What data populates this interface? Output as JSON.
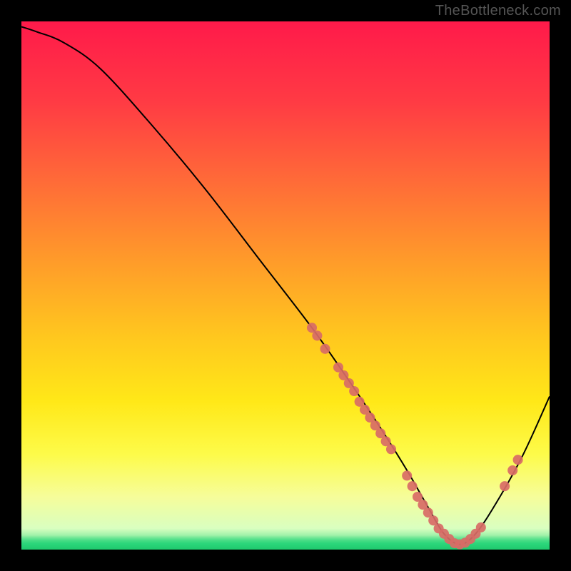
{
  "watermark": "TheBottleneck.com",
  "chart_data": {
    "type": "line",
    "title": "",
    "xlabel": "",
    "ylabel": "",
    "xlim": [
      0,
      100
    ],
    "ylim": [
      0,
      100
    ],
    "series": [
      {
        "name": "bottleneck-curve",
        "x": [
          0,
          3,
          8,
          15,
          25,
          35,
          45,
          55,
          62,
          68,
          73,
          77,
          80,
          83,
          86,
          90,
          95,
          100
        ],
        "y": [
          99,
          98,
          96,
          91,
          80,
          68,
          55,
          42,
          32,
          23,
          15,
          8,
          3,
          1,
          3,
          9,
          18,
          29
        ]
      }
    ],
    "scatter_clusters": [
      {
        "name": "dots-on-curve",
        "color": "#d86b66",
        "points": [
          {
            "x": 55,
            "y": 42
          },
          {
            "x": 56,
            "y": 40.5
          },
          {
            "x": 57.5,
            "y": 38
          },
          {
            "x": 60,
            "y": 34.5
          },
          {
            "x": 61,
            "y": 33
          },
          {
            "x": 62,
            "y": 31.5
          },
          {
            "x": 63,
            "y": 30
          },
          {
            "x": 64,
            "y": 28
          },
          {
            "x": 65,
            "y": 26.5
          },
          {
            "x": 66,
            "y": 25
          },
          {
            "x": 67,
            "y": 23.5
          },
          {
            "x": 68,
            "y": 22
          },
          {
            "x": 69,
            "y": 20.5
          },
          {
            "x": 70,
            "y": 19
          },
          {
            "x": 73,
            "y": 14
          },
          {
            "x": 74,
            "y": 12
          },
          {
            "x": 75,
            "y": 10
          },
          {
            "x": 76,
            "y": 8.5
          },
          {
            "x": 77,
            "y": 7
          },
          {
            "x": 78,
            "y": 5.5
          },
          {
            "x": 79,
            "y": 4
          },
          {
            "x": 80,
            "y": 3
          },
          {
            "x": 81,
            "y": 2
          },
          {
            "x": 82,
            "y": 1.2
          },
          {
            "x": 83,
            "y": 1
          },
          {
            "x": 84,
            "y": 1.3
          },
          {
            "x": 85,
            "y": 2
          },
          {
            "x": 86,
            "y": 3
          },
          {
            "x": 87,
            "y": 4.2
          },
          {
            "x": 91.5,
            "y": 12
          },
          {
            "x": 93,
            "y": 15
          },
          {
            "x": 94,
            "y": 17
          }
        ]
      }
    ],
    "gradient_stops": [
      {
        "pos": 0.0,
        "color": "#ff1a4a"
      },
      {
        "pos": 0.15,
        "color": "#ff3a44"
      },
      {
        "pos": 0.3,
        "color": "#ff6a38"
      },
      {
        "pos": 0.45,
        "color": "#ff9a2a"
      },
      {
        "pos": 0.6,
        "color": "#ffc81e"
      },
      {
        "pos": 0.72,
        "color": "#ffe818"
      },
      {
        "pos": 0.82,
        "color": "#fdfb4a"
      },
      {
        "pos": 0.9,
        "color": "#f6fd9a"
      },
      {
        "pos": 0.96,
        "color": "#d9ffc0"
      },
      {
        "pos": 1.0,
        "color": "#2bd67a"
      }
    ]
  }
}
